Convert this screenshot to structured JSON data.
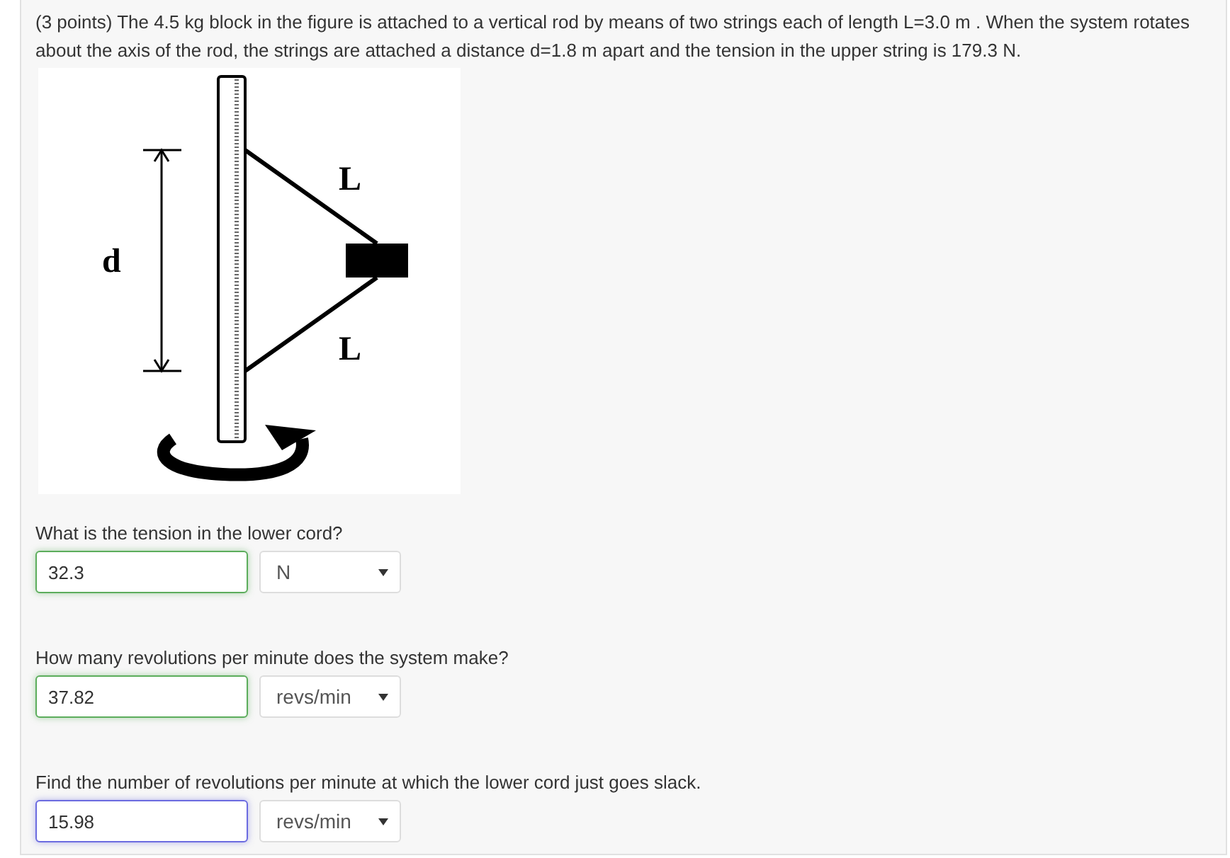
{
  "problem": {
    "text": "(3 points) The 4.5 kg block in the figure is attached to a vertical rod by means of two strings each of length L=3.0 m . When the system rotates about the axis of the rod, the strings are attached a distance d=1.8 m apart and the tension in the upper string is 179.3 N."
  },
  "figure": {
    "labels": [
      "L",
      "L",
      "d"
    ]
  },
  "questions": [
    {
      "prompt": "What is the tension in the lower cord?",
      "answer": "32.3",
      "unit": "N",
      "correct": true,
      "focused": false
    },
    {
      "prompt": "How many revolutions per minute does the system make?",
      "answer": "37.82",
      "unit": "revs/min",
      "correct": true,
      "focused": false
    },
    {
      "prompt": "Find the number of revolutions per minute at which the lower cord just goes slack.",
      "answer": "15.98",
      "unit": "revs/min",
      "correct": false,
      "focused": true
    }
  ]
}
